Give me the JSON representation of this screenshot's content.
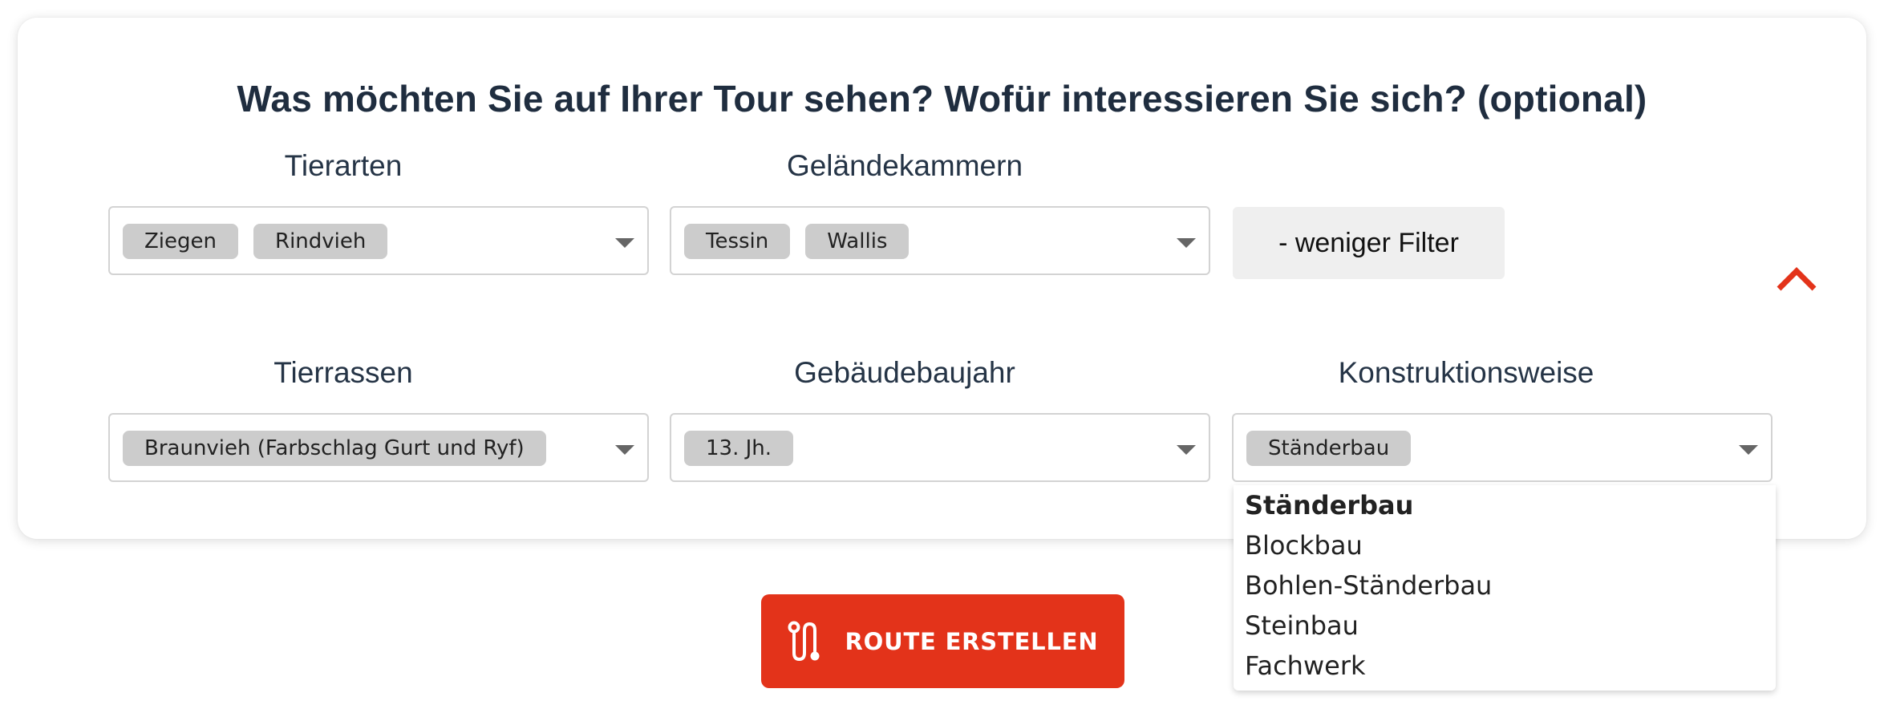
{
  "heading": "Was möchten Sie auf Ihrer Tour sehen? Wofür interessieren Sie sich? (optional)",
  "filters": {
    "tierarten": {
      "label": "Tierarten",
      "chips": [
        "Ziegen",
        "Rindvieh"
      ]
    },
    "gelaendekammern": {
      "label": "Geländekammern",
      "chips": [
        "Tessin",
        "Wallis"
      ]
    },
    "tierrassen": {
      "label": "Tierrassen",
      "chips": [
        "Braunvieh (Farbschlag Gurt und Ryf)"
      ]
    },
    "gebaeudebaujahr": {
      "label": "Gebäudebaujahr",
      "chips": [
        "13. Jh."
      ]
    },
    "konstruktionsweise": {
      "label": "Konstruktionsweise",
      "chips": [
        "Ständerbau"
      ]
    }
  },
  "less_filters_label": "- weniger Filter",
  "dropdown": {
    "options": [
      "Ständerbau",
      "Blockbau",
      "Bohlen-Ständerbau",
      "Steinbau",
      "Fachwerk"
    ],
    "selected": "Ständerbau"
  },
  "route_button": {
    "label": "ROUTE ERSTELLEN",
    "icon": "route-icon"
  },
  "colors": {
    "accent": "#e3331a",
    "heading": "#1f2d3f",
    "chip": "#cccccc",
    "secondary_button": "#efefef"
  },
  "icons": {
    "collapse": "chevron-up-icon",
    "dropdown": "caret-down-icon"
  }
}
